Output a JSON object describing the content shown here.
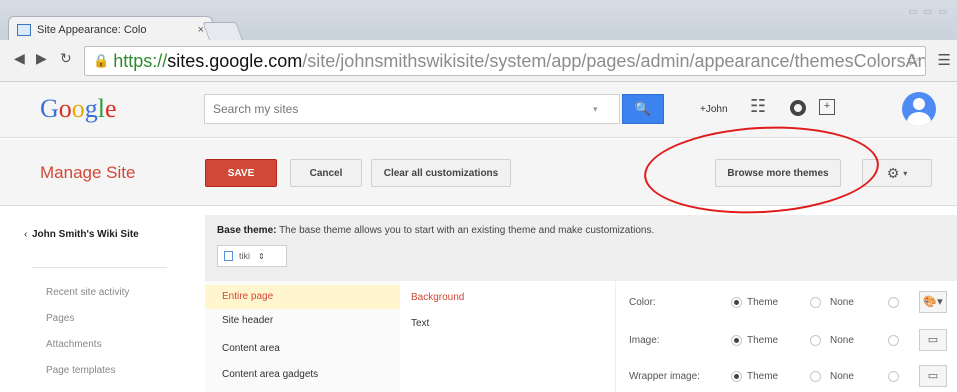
{
  "browser": {
    "tab_title": "Site Appearance: Colo",
    "tab_close": "×",
    "url_scheme": "https://",
    "url_host": "sites.google.com",
    "url_path": "/site/johnsmithswikisite/system/app/pages/admin/appearance/themesColorsAnd"
  },
  "header": {
    "logo_parts": [
      "G",
      "o",
      "o",
      "g",
      "l",
      "e"
    ],
    "search_placeholder": "Search my sites",
    "user_link": "+John"
  },
  "manage": {
    "title": "Manage Site",
    "save_label": "SAVE",
    "cancel_label": "Cancel",
    "clear_label": "Clear all customizations",
    "browse_label": "Browse more themes"
  },
  "sidebar": {
    "chevron": "‹",
    "site_name": "John Smith's Wiki Site",
    "items": [
      "Recent site activity",
      "Pages",
      "Attachments",
      "Page templates"
    ]
  },
  "content": {
    "base_theme_label": "Base theme:",
    "base_theme_text": "The base theme allows you to start with an existing theme and make customizations.",
    "theme_select_value": "tiki",
    "sections": [
      "Entire page",
      "Site header",
      "Content area",
      "Content area gadgets"
    ],
    "elements": [
      "Background",
      "Text"
    ],
    "properties": [
      {
        "label": "Color:",
        "theme": "Theme",
        "none": "None",
        "tool": "🎨▾"
      },
      {
        "label": "Image:",
        "theme": "Theme",
        "none": "None",
        "tool": "▭"
      },
      {
        "label": "Wrapper image:",
        "theme": "Theme",
        "none": "None",
        "tool": "▭"
      }
    ]
  },
  "colors": {
    "accent": "#d14836",
    "blue": "#3d83f0",
    "annotation": "#e01b1b"
  }
}
